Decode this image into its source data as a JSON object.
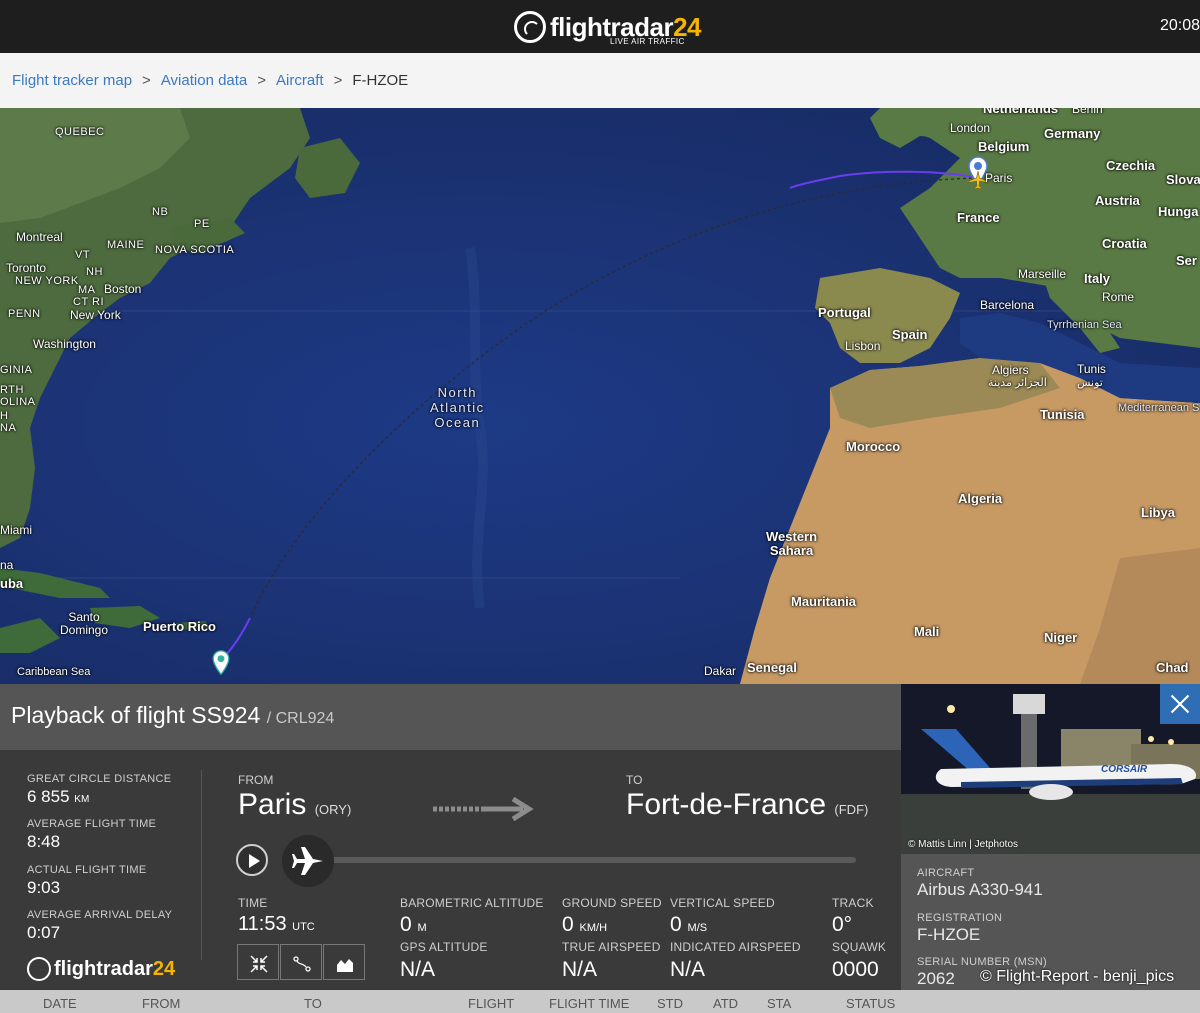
{
  "header": {
    "brand_main": "flightradar",
    "brand_num": "24",
    "tagline": "LIVE AIR TRAFFIC",
    "clock": "20:08"
  },
  "breadcrumb": {
    "items": [
      "Flight tracker map",
      "Aviation data",
      "Aircraft"
    ],
    "separator": ">",
    "current": "F-HZOE"
  },
  "map": {
    "labels": {
      "quebec": "QUEBEC",
      "nb": "NB",
      "pe": "PE",
      "maine": "MAINE",
      "nova_scotia": "NOVA SCOTIA",
      "montreal": "Montreal",
      "vt": "VT",
      "toronto": "Toronto",
      "new_york_state": "NEW YORK",
      "nh": "NH",
      "ma": "MA",
      "boston": "Boston",
      "ct_ri": "CT RI",
      "penn": "PENN",
      "new_york": "New York",
      "washington": "Washington",
      "ginia": "GINIA",
      "rth_olina": "RTH\nOLINA",
      "h_na": "H\nNA",
      "miami": "Miami",
      "na": "na",
      "uba": "uba",
      "santo_domingo": "Santo\nDomingo",
      "puerto_rico": "Puerto Rico",
      "caribbean_sea": "Caribbean Sea",
      "ocean": "North\nAtlantic\nOcean",
      "netherlands": "Netherlands",
      "berlin": "Berlin",
      "london": "London",
      "germany": "Germany",
      "belgium": "Belgium",
      "czechia": "Czechia",
      "slova": "Slova",
      "paris": "Paris",
      "austria": "Austria",
      "hunga": "Hunga",
      "france": "France",
      "croatia": "Croatia",
      "ser": "Ser",
      "marseille": "Marseille",
      "italy": "Italy",
      "rome": "Rome",
      "barcelona": "Barcelona",
      "portugal": "Portugal",
      "spain": "Spain",
      "lisbon": "Lisbon",
      "tyrrhenian": "Tyrrhenian Sea",
      "algiers": "Algiers",
      "algiers_ar": "الجزائر مدينة",
      "tunis": "Tunis",
      "tunis_ar": "تونس",
      "mediterranean": "Mediterranean S",
      "tunisia": "Tunisia",
      "morocco": "Morocco",
      "algeria": "Algeria",
      "libya": "Libya",
      "western_sahara": "Western\nSahara",
      "mauritania": "Mauritania",
      "mali": "Mali",
      "niger": "Niger",
      "dakar": "Dakar",
      "senegal": "Senegal",
      "chad": "Chad"
    },
    "colors": {
      "ocean": "#1c3477",
      "land_green": "#3f6b3a",
      "desert": "#c79a64",
      "track": "#6a3df0"
    }
  },
  "playback": {
    "title": "Playback of flight SS924",
    "callsign": "/ CRL924",
    "stats": [
      {
        "label": "GREAT CIRCLE DISTANCE",
        "value": "6 855",
        "unit": "KM"
      },
      {
        "label": "AVERAGE FLIGHT TIME",
        "value": "8:48",
        "unit": ""
      },
      {
        "label": "ACTUAL FLIGHT TIME",
        "value": "9:03",
        "unit": ""
      },
      {
        "label": "AVERAGE ARRIVAL DELAY",
        "value": "0:07",
        "unit": ""
      }
    ],
    "from": {
      "label": "FROM",
      "city": "Paris",
      "code": "(ORY)"
    },
    "to": {
      "label": "TO",
      "city": "Fort-de-France",
      "code": "(FDF)"
    },
    "time": {
      "label": "TIME",
      "value": "11:53",
      "unit": "UTC"
    },
    "data": {
      "baro_alt": {
        "label": "BAROMETRIC ALTITUDE",
        "value": "0",
        "unit": "M"
      },
      "gps_alt": {
        "label": "GPS ALTITUDE",
        "value": "N/A"
      },
      "ground_speed": {
        "label": "GROUND SPEED",
        "value": "0",
        "unit": "KM/H"
      },
      "true_airspeed": {
        "label": "TRUE AIRSPEED",
        "value": "N/A"
      },
      "vertical_speed": {
        "label": "VERTICAL SPEED",
        "value": "0",
        "unit": "M/S"
      },
      "indicated_airspeed": {
        "label": "INDICATED AIRSPEED",
        "value": "N/A"
      },
      "track": {
        "label": "TRACK",
        "value": "0°"
      },
      "squawk": {
        "label": "SQUAWK",
        "value": "0000"
      }
    },
    "progress": 0.0
  },
  "aircraft_panel": {
    "photo_credit": "© Mattis Linn | Jetphotos",
    "livery_text": "CORSAIR",
    "aircraft_label": "AIRCRAFT",
    "aircraft_value": "Airbus A330-941",
    "registration_label": "REGISTRATION",
    "registration_value": "F-HZOE",
    "serial_label": "SERIAL NUMBER (MSN)",
    "serial_value": "2062"
  },
  "watermark": "© Flight-Report - benji_pics",
  "table_header": [
    "DATE",
    "FROM",
    "TO",
    "FLIGHT",
    "FLIGHT TIME",
    "STD",
    "ATD",
    "STA",
    "STATUS"
  ]
}
